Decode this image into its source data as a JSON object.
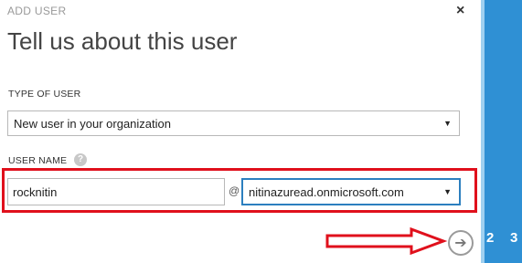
{
  "dialog": {
    "header": "ADD USER",
    "title": "Tell us about this user",
    "close_glyph": "×"
  },
  "type_of_user": {
    "label": "TYPE OF USER",
    "selected": "New user in your organization"
  },
  "user_name": {
    "label": "USER NAME",
    "help_glyph": "?",
    "value": "rocknitin",
    "at_symbol": "@",
    "domain_selected": "nitinazuread.onmicrosoft.com"
  },
  "wizard": {
    "steps": [
      "2",
      "3"
    ],
    "next_glyph": "➔"
  },
  "colors": {
    "accent": "#2f90d4",
    "annotation_red": "#e0101c"
  },
  "icons": {
    "close": "close-icon",
    "help": "help-icon",
    "dropdown": "chevron-down-icon",
    "next": "arrow-right-icon"
  }
}
